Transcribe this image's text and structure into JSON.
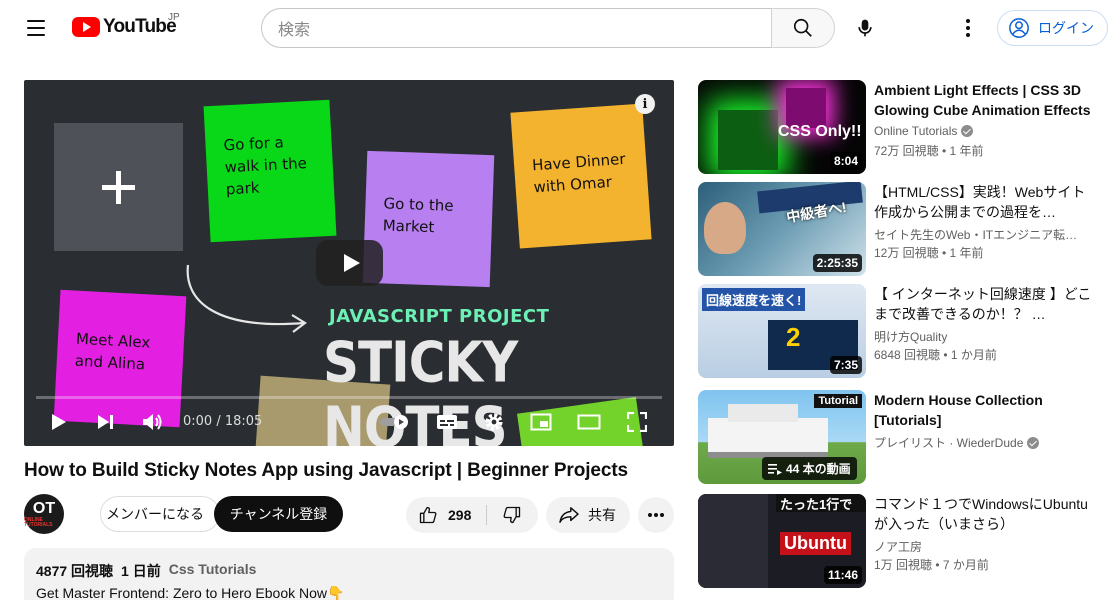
{
  "header": {
    "logo_text": "YouTube",
    "region": "JP",
    "search_placeholder": "検索",
    "login_label": "ログイン"
  },
  "player": {
    "notes": [
      "Go for a walk in the park",
      "Go to the Market",
      "Have Dinner with Omar",
      "Meet Alex and Alina"
    ],
    "overlay_subtitle": "JAVASCRIPT PROJECT",
    "overlay_title": "STICKY NOTES",
    "time": "0:00 / 18:05",
    "progress": 0
  },
  "video": {
    "title": "How to Build Sticky Notes App using Javascript | Beginner Projects",
    "channel_avatar_text": "OT",
    "channel_avatar_sub": "ONLINE TUTORIALS",
    "member_label": "メンバーになる",
    "subscribe_label": "チャンネル登録",
    "likes": "298",
    "share_label": "共有",
    "views": "4877 回視聴",
    "date": "1 日前",
    "tag": "Css Tutorials",
    "description": "Get Master Frontend: Zero to Hero Ebook Now👇"
  },
  "recommendations": [
    {
      "title": "Ambient Light Effects | CSS 3D Glowing Cube Animation Effects",
      "channel": "Online Tutorials",
      "verified": true,
      "meta": "72万 回視聴 • 1 年前",
      "duration": "8:04",
      "thumb_text": "CSS Only!!"
    },
    {
      "title": "【HTML/CSS】実践！Webサイト作成から公開までの過程を…",
      "channel": "セイト先生のWeb・ITエンジニア転…",
      "verified": false,
      "meta": "12万 回視聴 • 1 年前",
      "duration": "2:25:35",
      "thumb_text": "中級者へ!"
    },
    {
      "title": "【 インターネット回線速度 】どこまで改善できるのか！？ …",
      "channel": "明け方Quality",
      "verified": false,
      "meta": "6848 回視聴 • 1 か月前",
      "duration": "7:35",
      "thumb_text": "回線速度を速く!"
    },
    {
      "title": "Modern House Collection [Tutorials]",
      "channel": "プレイリスト · WiederDude",
      "verified": true,
      "meta": "",
      "duration": "",
      "playlist_label": "44 本の動画",
      "thumb_text": "Tutorial"
    },
    {
      "title": "コマンド１つでWindowsにUbuntuが入った（いまさら）",
      "channel": "ノア工房",
      "verified": false,
      "meta": "1万 回視聴 • 7 か月前",
      "duration": "11:46",
      "thumb_text": "Ubuntu"
    }
  ]
}
